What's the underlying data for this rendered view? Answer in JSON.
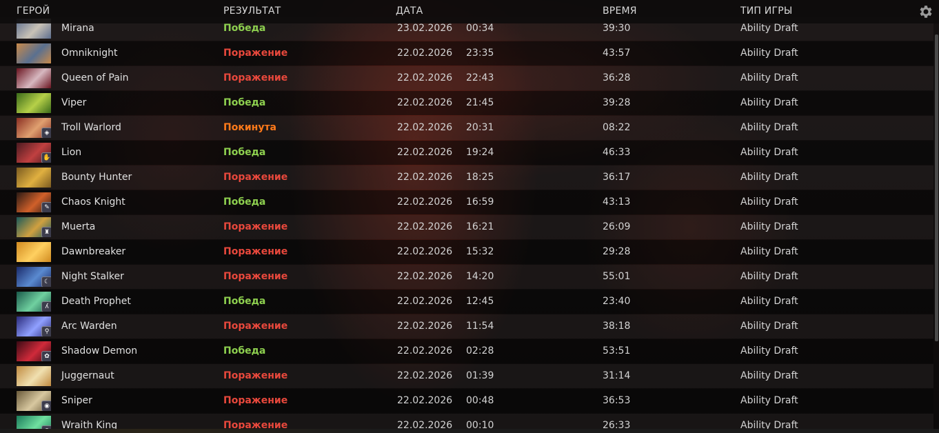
{
  "header": {
    "hero": "ГЕРОЙ",
    "result": "РЕЗУЛЬТАТ",
    "date": "ДАТА",
    "duration": "ВРЕМЯ",
    "mode": "ТИП ИГРЫ",
    "settings_icon": "gear-icon"
  },
  "colors": {
    "win": "#8ed04f",
    "loss": "#e8483c",
    "abandon": "#ff7a1a"
  },
  "matches": [
    {
      "hero": "Mirana",
      "result": "Победа",
      "kind": "win",
      "date": "23.02.2026",
      "time": "00:34",
      "duration": "39:30",
      "mode": "Ability Draft",
      "c1": "#5d6e8e",
      "c2": "#c9c2b6",
      "badge": ""
    },
    {
      "hero": "Omniknight",
      "result": "Поражение",
      "kind": "loss",
      "date": "22.02.2026",
      "time": "23:35",
      "duration": "43:57",
      "mode": "Ability Draft",
      "c1": "#c98a4a",
      "c2": "#5a7090",
      "badge": ""
    },
    {
      "hero": "Queen of Pain",
      "result": "Поражение",
      "kind": "loss",
      "date": "22.02.2026",
      "time": "22:43",
      "duration": "36:28",
      "mode": "Ability Draft",
      "c1": "#6a1420",
      "c2": "#d7b8c0",
      "badge": ""
    },
    {
      "hero": "Viper",
      "result": "Победа",
      "kind": "win",
      "date": "22.02.2026",
      "time": "21:45",
      "duration": "39:28",
      "mode": "Ability Draft",
      "c1": "#3a6a1a",
      "c2": "#b6d048",
      "badge": ""
    },
    {
      "hero": "Troll Warlord",
      "result": "Покинута",
      "kind": "abandon",
      "date": "22.02.2026",
      "time": "20:31",
      "duration": "08:22",
      "mode": "Ability Draft",
      "c1": "#8a2e22",
      "c2": "#e0a070",
      "badge": "◈"
    },
    {
      "hero": "Lion",
      "result": "Победа",
      "kind": "win",
      "date": "22.02.2026",
      "time": "19:24",
      "duration": "46:33",
      "mode": "Ability Draft",
      "c1": "#4a1a20",
      "c2": "#c04040",
      "badge": "✋"
    },
    {
      "hero": "Bounty Hunter",
      "result": "Поражение",
      "kind": "loss",
      "date": "22.02.2026",
      "time": "18:25",
      "duration": "36:17",
      "mode": "Ability Draft",
      "c1": "#7a5a20",
      "c2": "#e0b040",
      "badge": ""
    },
    {
      "hero": "Chaos Knight",
      "result": "Победа",
      "kind": "win",
      "date": "22.02.2026",
      "time": "16:59",
      "duration": "43:13",
      "mode": "Ability Draft",
      "c1": "#2a1a14",
      "c2": "#d0602a",
      "badge": "✎"
    },
    {
      "hero": "Muerta",
      "result": "Поражение",
      "kind": "loss",
      "date": "22.02.2026",
      "time": "16:21",
      "duration": "26:09",
      "mode": "Ability Draft",
      "c1": "#1a5a5a",
      "c2": "#d0a040",
      "badge": "♜"
    },
    {
      "hero": "Dawnbreaker",
      "result": "Поражение",
      "kind": "loss",
      "date": "22.02.2026",
      "time": "15:32",
      "duration": "29:28",
      "mode": "Ability Draft",
      "c1": "#d08a20",
      "c2": "#ffd060",
      "badge": ""
    },
    {
      "hero": "Night Stalker",
      "result": "Поражение",
      "kind": "loss",
      "date": "22.02.2026",
      "time": "14:20",
      "duration": "55:01",
      "mode": "Ability Draft",
      "c1": "#1a2a6a",
      "c2": "#5a8ad0",
      "badge": "☾"
    },
    {
      "hero": "Death Prophet",
      "result": "Победа",
      "kind": "win",
      "date": "22.02.2026",
      "time": "12:45",
      "duration": "23:40",
      "mode": "Ability Draft",
      "c1": "#1a5a4a",
      "c2": "#70d0a0",
      "badge": "ʎ"
    },
    {
      "hero": "Arc Warden",
      "result": "Поражение",
      "kind": "loss",
      "date": "22.02.2026",
      "time": "11:54",
      "duration": "38:18",
      "mode": "Ability Draft",
      "c1": "#2a2a7a",
      "c2": "#90a0ff",
      "badge": "⚲"
    },
    {
      "hero": "Shadow Demon",
      "result": "Победа",
      "kind": "win",
      "date": "22.02.2026",
      "time": "02:28",
      "duration": "53:51",
      "mode": "Ability Draft",
      "c1": "#3a0a14",
      "c2": "#d02a3a",
      "badge": "✿"
    },
    {
      "hero": "Juggernaut",
      "result": "Поражение",
      "kind": "loss",
      "date": "22.02.2026",
      "time": "01:39",
      "duration": "31:14",
      "mode": "Ability Draft",
      "c1": "#c08a40",
      "c2": "#f0e0b0",
      "badge": ""
    },
    {
      "hero": "Sniper",
      "result": "Поражение",
      "kind": "loss",
      "date": "22.02.2026",
      "time": "00:48",
      "duration": "36:53",
      "mode": "Ability Draft",
      "c1": "#6a5a3a",
      "c2": "#d8c8a0",
      "badge": "◉"
    },
    {
      "hero": "Wraith King",
      "result": "Поражение",
      "kind": "loss",
      "date": "22.02.2026",
      "time": "00:10",
      "duration": "26:33",
      "mode": "Ability Draft",
      "c1": "#1a7a5a",
      "c2": "#70e0a0",
      "badge": "●"
    }
  ]
}
